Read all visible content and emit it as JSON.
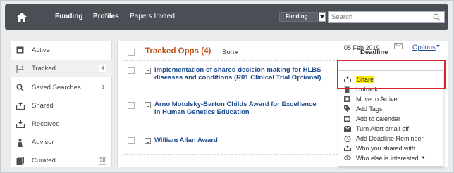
{
  "nav": {
    "items": [
      "Funding",
      "Profiles",
      "Papers Invited"
    ],
    "funding_select": "Funding",
    "search_placeholder": "Search"
  },
  "sidebar": {
    "items": [
      {
        "label": "Active",
        "icon": "active-icon"
      },
      {
        "label": "Tracked",
        "icon": "flag-icon",
        "count": "4"
      },
      {
        "label": "Saved Searches",
        "icon": "search-icon",
        "count": "3"
      },
      {
        "label": "Shared",
        "icon": "share-icon"
      },
      {
        "label": "Received",
        "icon": "inbox-icon"
      },
      {
        "label": "Advisor",
        "icon": "advisor-icon"
      },
      {
        "label": "Curated",
        "icon": "curated-icon",
        "count": "38"
      }
    ]
  },
  "main": {
    "title": "Tracked Opps (4)",
    "sort_label": "Sort",
    "deadline_header": "Deadline",
    "opportunities": [
      {
        "title": "Implementation of shared decision making for HLBS diseases and conditions (R01 Clinical Trial Optional)",
        "deadline": "05 Feb 2019",
        "options": "Options"
      },
      {
        "title": "Arno Motulsky-Barton Childs Award for Excellence in Human Genetics Education"
      },
      {
        "title": "William Allan Award"
      }
    ]
  },
  "menu": {
    "items": [
      "Share",
      "Untrack",
      "Move to Active",
      "Add Tags",
      "Add to calendar",
      "Turn Alert email off",
      "Add Deadline Reminder",
      "Who you shared with",
      "Who else is interested"
    ]
  },
  "colors": {
    "topbar": "#4a4f56",
    "accent": "#c0551f",
    "link": "#1d4c8e",
    "highlight": "#fff200",
    "callout": "#d9262f"
  }
}
